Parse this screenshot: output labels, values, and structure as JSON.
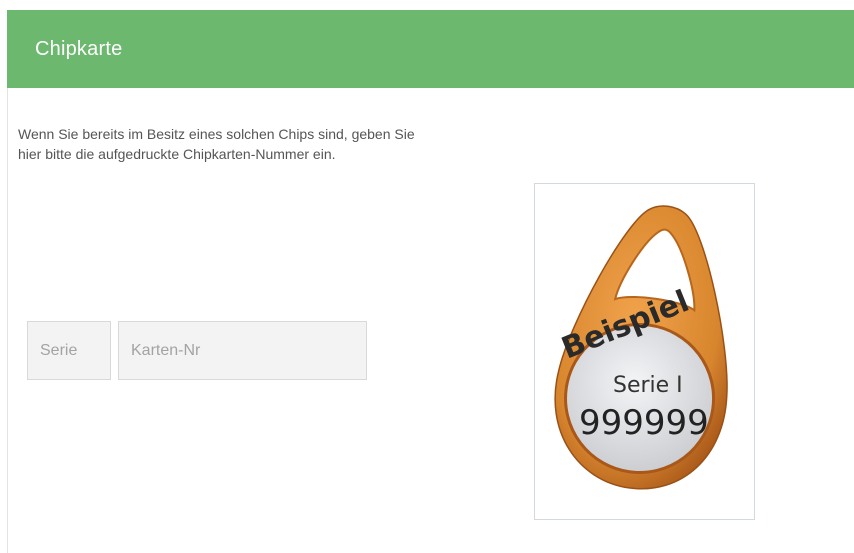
{
  "panel": {
    "title": "Chipkarte",
    "intro_line1": "Wenn Sie bereits im Besitz eines solchen Chips sind, geben Sie",
    "intro_line2": "hier bitte die aufgedruckte Chipkarten-Nummer ein."
  },
  "form": {
    "serie_placeholder": "Serie",
    "kartennr_placeholder": "Karten-Nr"
  },
  "example_image": {
    "stamp": "Beispiel",
    "serie_text": "Serie I",
    "number_text": "999999"
  },
  "colors": {
    "header": "#6bb86e",
    "fob": "#d8862e",
    "fob_dark": "#b8661c",
    "disc": "#e2e3e6"
  }
}
